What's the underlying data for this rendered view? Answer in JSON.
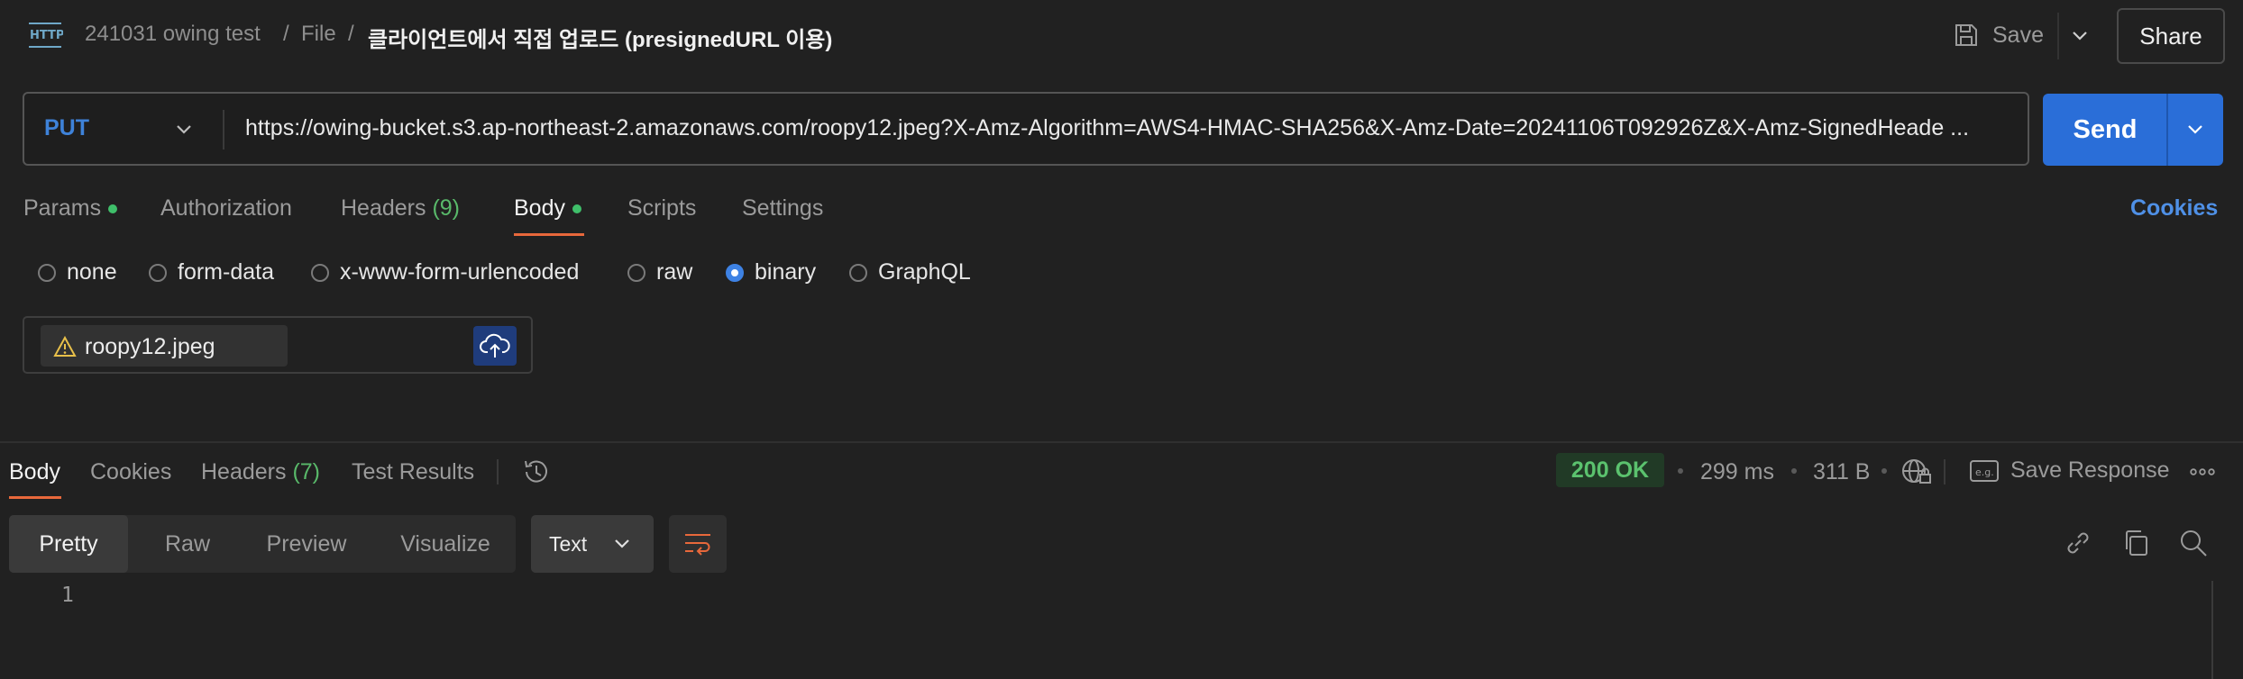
{
  "breadcrumb": {
    "items": [
      "241031 owing test",
      "File"
    ],
    "separator": "/",
    "current": "클라이언트에서 직접 업로드 (presignedURL 이용)"
  },
  "toolbar": {
    "save_label": "Save",
    "share_label": "Share"
  },
  "request": {
    "method": "PUT",
    "url": "https://owing-bucket.s3.ap-northeast-2.amazonaws.com/roopy12.jpeg?X-Amz-Algorithm=AWS4-HMAC-SHA256&X-Amz-Date=20241106T092926Z&X-Amz-SignedHeade ...",
    "send_label": "Send"
  },
  "request_tabs": [
    {
      "label": "Params"
    },
    {
      "label": "Authorization"
    },
    {
      "label": "Headers",
      "count": "(9)"
    },
    {
      "label": "Body"
    },
    {
      "label": "Scripts"
    },
    {
      "label": "Settings"
    }
  ],
  "cookies_label": "Cookies",
  "body_types": [
    {
      "label": "none",
      "selected": false
    },
    {
      "label": "form-data",
      "selected": false
    },
    {
      "label": "x-www-form-urlencoded",
      "selected": false
    },
    {
      "label": "raw",
      "selected": false
    },
    {
      "label": "binary",
      "selected": true
    },
    {
      "label": "GraphQL",
      "selected": false
    }
  ],
  "binary_file": {
    "name": "roopy12.jpeg"
  },
  "response": {
    "tabs": [
      {
        "label": "Body"
      },
      {
        "label": "Cookies"
      },
      {
        "label": "Headers",
        "count": "(7)"
      },
      {
        "label": "Test Results"
      }
    ],
    "status": "200 OK",
    "time": "299 ms",
    "size": "311 B",
    "save_response_label": "Save Response",
    "views": [
      "Pretty",
      "Raw",
      "Preview",
      "Visualize"
    ],
    "format": "Text",
    "line_numbers": [
      "1"
    ]
  },
  "colors": {
    "accent": "#2a6ed8",
    "method": "#3e82d9",
    "active_underline": "#e8683b",
    "status_ok": "#5bc26e"
  }
}
